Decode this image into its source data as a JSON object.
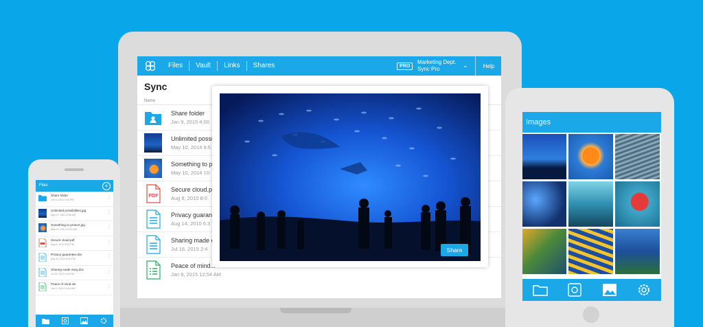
{
  "laptop": {
    "topbar": {
      "nav": [
        "Files",
        "Vault",
        "Links",
        "Shares"
      ],
      "pro_badge": "PRO",
      "dept_line1": "Marketing Dept.",
      "dept_line2": "Sync Pro",
      "help": "Help"
    },
    "title": "Sync",
    "column_header": "Name",
    "files": [
      {
        "name": "Share folder",
        "date": "Jan 9, 2015  4:00",
        "icon": "folder-icon"
      },
      {
        "name": "Unlimited possibi",
        "date": "May 10, 2014  9:5",
        "icon": "photo-thumbnail"
      },
      {
        "name": "Something to pr",
        "date": "May 10, 2014  10:",
        "icon": "photo-thumbnail"
      },
      {
        "name": "Secure cloud.pd",
        "date": "Aug 8, 2010  8:0",
        "icon": "pdf-icon"
      },
      {
        "name": "Privacy guarante",
        "date": "Aug 14, 2010  6:3",
        "icon": "doc-icon"
      },
      {
        "name": "Sharing made e",
        "date": "Jul 16, 2015  2:4",
        "icon": "doc-icon"
      },
      {
        "name": "Peace of mind.x",
        "date": "Jan 9, 2015  12:54 AM",
        "icon": "sheet-icon"
      }
    ],
    "modal": {
      "share_label": "Share"
    }
  },
  "phone": {
    "title": "Files",
    "add_icon": "+",
    "files": [
      {
        "name": "Share folder",
        "date": "Jan 9, 2015  4:00 PM",
        "icon": "folder-icon"
      },
      {
        "name": "Unlimited possibilities.jpg",
        "date": "May 10, 2014  9:56 AM",
        "icon": "photo-thumbnail"
      },
      {
        "name": "Something to protect.jpg",
        "date": "May 10, 2014  10:00 AM",
        "icon": "photo-thumbnail"
      },
      {
        "name": "Secure cloud.pdf",
        "date": "Aug 8, 2010  8:05 PM",
        "icon": "pdf-icon"
      },
      {
        "name": "Privacy guarantee.doc",
        "date": "Aug 14, 2010  6:30 PM",
        "icon": "doc-icon"
      },
      {
        "name": "Sharing made easy.doc",
        "date": "Jul 16, 2015  2:45 PM",
        "icon": "doc-icon"
      },
      {
        "name": "Peace of mind.xls",
        "date": "Jan 9, 2015  12:54 AM",
        "icon": "sheet-icon"
      }
    ],
    "tabs": [
      "folder-icon",
      "vault-icon",
      "image-icon",
      "gear-icon"
    ]
  },
  "tablet": {
    "title": "Images",
    "tabs": [
      "folder-icon",
      "vault-icon",
      "image-icon",
      "gear-icon"
    ]
  },
  "colors": {
    "background": "#0aa6ea",
    "brand": "#1ba8e8",
    "pdf": "#e74c3c",
    "doc": "#1ba8e8",
    "sheet": "#27ae60"
  }
}
